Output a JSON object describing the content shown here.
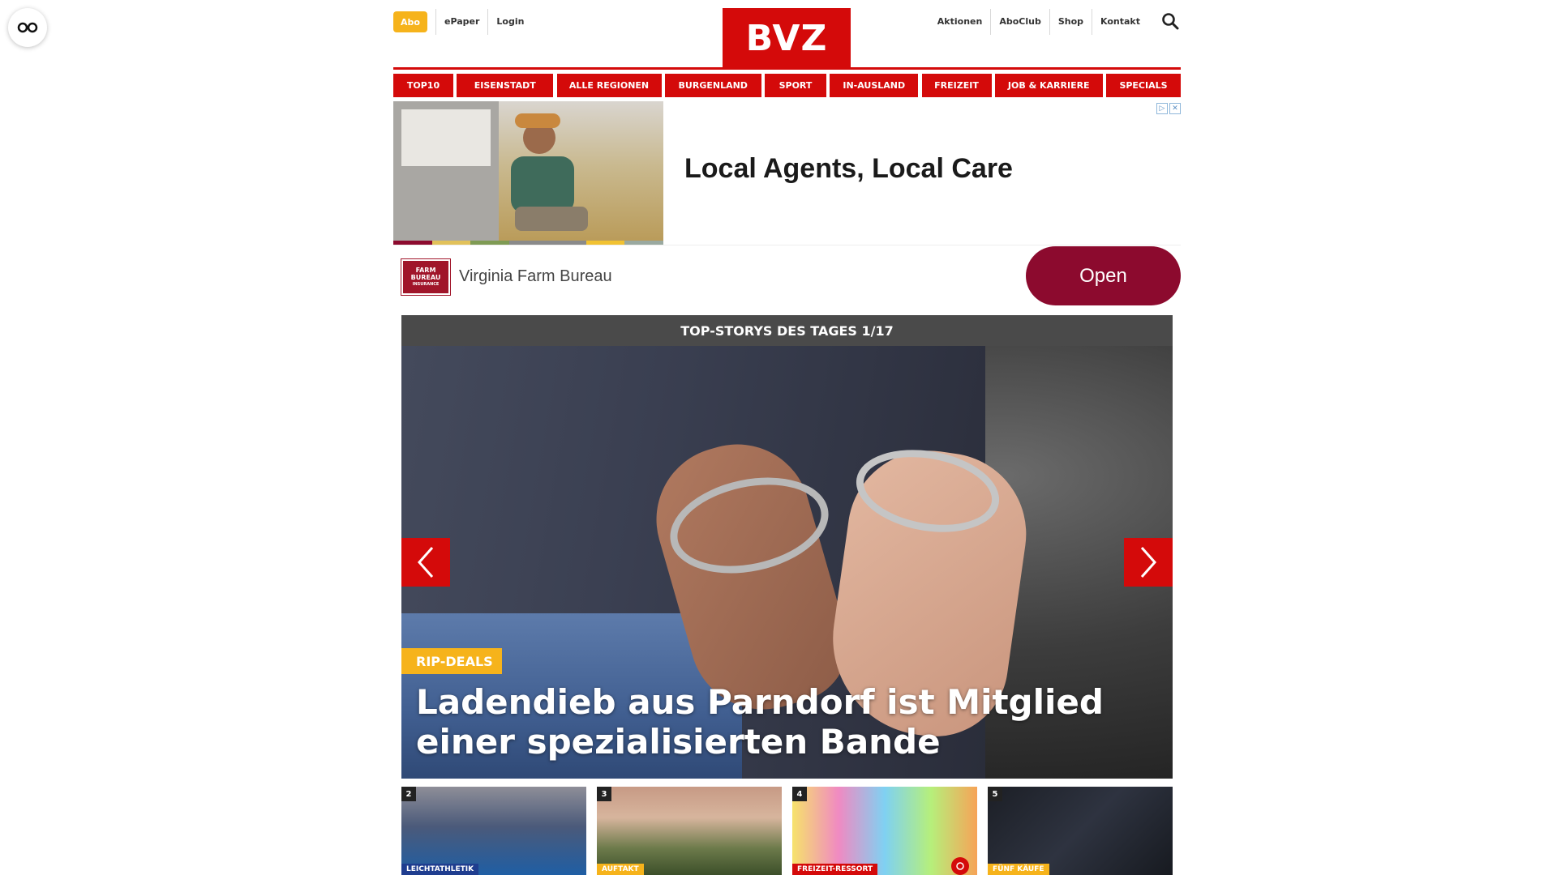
{
  "header": {
    "abo_label": "Abo",
    "left_links": [
      "ePaper",
      "Login"
    ],
    "right_links": [
      "Aktionen",
      "AboClub",
      "Shop",
      "Kontakt"
    ],
    "logo": "BVZ"
  },
  "nav": {
    "items": [
      "TOP10",
      "EISENSTADT",
      "ALLE REGIONEN",
      "BURGENLAND",
      "SPORT",
      "IN-AUSLAND",
      "FREIZEIT",
      "JOB & KARRIERE",
      "SPECIALS"
    ]
  },
  "ad": {
    "headline": "Local Agents, Local Care",
    "advertiser": "Virginia Farm Bureau",
    "logo_lines": [
      "FARM",
      "BUREAU",
      "INSURANCE"
    ],
    "cta": "Open"
  },
  "top_stories": {
    "heading": "TOP-STORYS DES TAGES 1/17",
    "kicker": "RIP-DEALS",
    "title": "Ladendieb aus Parndorf ist Mitglied einer spezialisierten Bande"
  },
  "thumbnails": [
    {
      "num": "2",
      "tag": "LEICHTATHLETIK",
      "tag_color": "#1f3d8f"
    },
    {
      "num": "3",
      "tag": "AUFTAKT",
      "tag_color": "#f6b31b"
    },
    {
      "num": "4",
      "tag": "FREIZEIT-RESSORT",
      "tag_color": "#d40a0a"
    },
    {
      "num": "5",
      "tag": "FÜNF KÄUFE",
      "tag_color": "#f6b31b"
    }
  ],
  "colors": {
    "brand_red": "#d40a0a",
    "accent_yellow": "#f6b31b",
    "cta_maroon": "#8c0a2e"
  }
}
